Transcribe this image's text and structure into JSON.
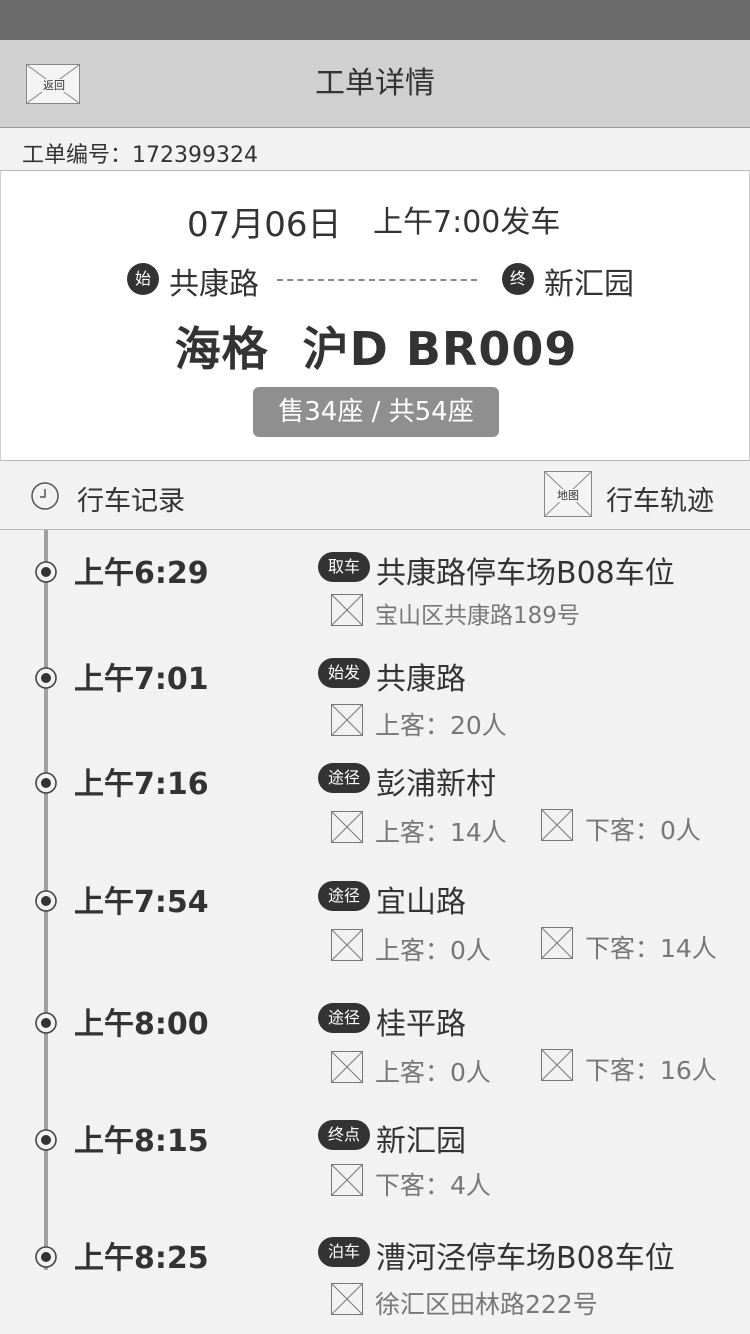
{
  "nav": {
    "back_label": "返回",
    "title": "工单详情"
  },
  "order": {
    "label": "工单编号：",
    "number": "172399324"
  },
  "trip": {
    "date": "07月06日",
    "depart": "上午7:00发车",
    "start_badge": "始",
    "start_name": "共康路",
    "end_badge": "终",
    "end_name": "新汇园",
    "plate": "海格  沪D BR009",
    "seats": "售34座 / 共54座"
  },
  "record_bar": {
    "record_label": "行车记录",
    "map_label": "地图",
    "track_label": "行车轨迹"
  },
  "stops": [
    {
      "time": "上午6:29",
      "tag": "取车",
      "name": "共康路停车场B08车位",
      "sub1": "宝山区共康路189号",
      "sub2": ""
    },
    {
      "time": "上午7:01",
      "tag": "始发",
      "name": "共康路",
      "sub1": "上客：20人",
      "sub2": ""
    },
    {
      "time": "上午7:16",
      "tag": "途径",
      "name": "彭浦新村",
      "sub1": "上客：14人",
      "sub2": "下客：0人"
    },
    {
      "time": "上午7:54",
      "tag": "途径",
      "name": "宜山路",
      "sub1": "上客：0人",
      "sub2": "下客：14人"
    },
    {
      "time": "上午8:00",
      "tag": "途径",
      "name": "桂平路",
      "sub1": "上客：0人",
      "sub2": "下客：16人"
    },
    {
      "time": "上午8:15",
      "tag": "终点",
      "name": "新汇园",
      "sub1": "下客：4人",
      "sub2": ""
    },
    {
      "time": "上午8:25",
      "tag": "泊车",
      "name": "漕河泾停车场B08车位",
      "sub1": "徐汇区田林路222号",
      "sub2": ""
    }
  ],
  "icons": {
    "back": "placeholder-image-icon",
    "clock": "clock-icon",
    "map": "placeholder-image-icon",
    "timeline_dot": "radio-dot-icon",
    "sub_item": "placeholder-image-icon"
  },
  "colors": {
    "status_bar": "#6b6b6b",
    "nav_bar": "#d0d0d0",
    "tag": "#333333",
    "seat_pill": "#8f8f8f"
  }
}
